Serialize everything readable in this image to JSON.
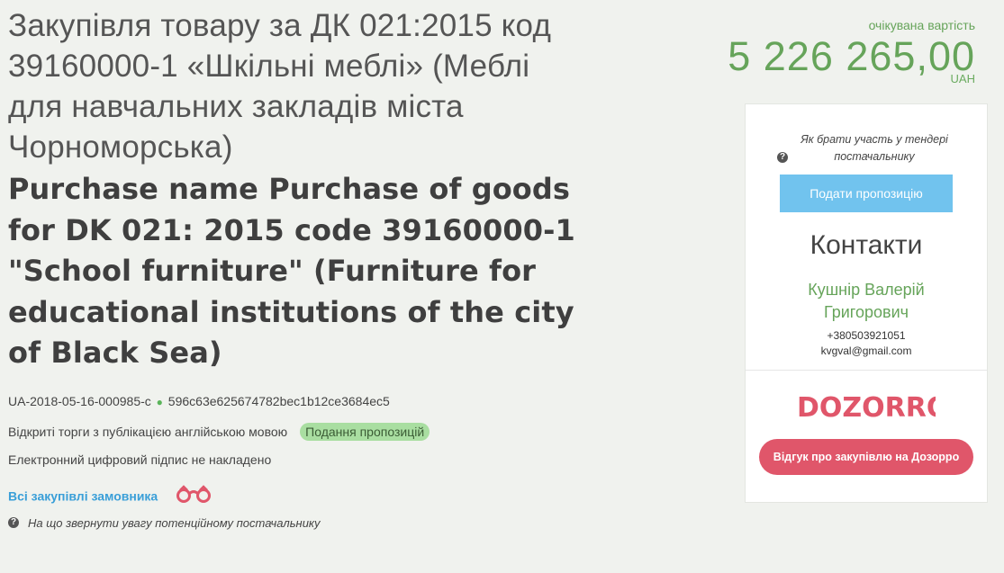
{
  "title_ua": "Закупівля товару за ДК 021:2015 код 39160000-1 «Шкільні меблі» (Меблі для навчальних закладів міста Чорноморська)",
  "title_en": "Purchase name Purchase of goods for DK 021: 2015 code 39160000-1 \"School furniture\" (Furniture for educational institutions of the city of Black Sea)",
  "tender_id": "UA-2018-05-16-000985-c",
  "dot": "●",
  "tender_hash": "596c63e625674782bec1b12ce3684ec5",
  "procedure_type": "Відкриті торги з публікацією англійською мовою",
  "status": "Подання пропозицій",
  "signature_text": "Електронний цифровий підпис не накладено",
  "all_purchases_link": "Всі закупівлі замовника",
  "supplier_hint": "На що звернути увагу потенційному постачальнику",
  "expected_label": "очікувана вартість",
  "expected_amount": "5 226 265,00",
  "currency": "UAH",
  "how_to_participate": "Як брати участь у тендері постачальнику",
  "submit_offer_label": "Подати пропозицію",
  "contacts_title": "Контакти",
  "contact_name": "Кушнір Валерій Григорович",
  "contact_phone": "+380503921051",
  "contact_email": "kvgval@gmail.com",
  "dozorro_logo": "DOZORRO",
  "dozorro_feedback_label": "Відгук про закупівлю на Дозорро",
  "colors": {
    "accent_green": "#66a45a",
    "submit_button": "#71c3ee",
    "dozorro_button": "#e0566a",
    "status_badge": "#a9dea1",
    "link_blue": "#3a9fd8"
  },
  "icons": {
    "question": "question-circle-icon",
    "binoculars": "binoculars-icon"
  }
}
